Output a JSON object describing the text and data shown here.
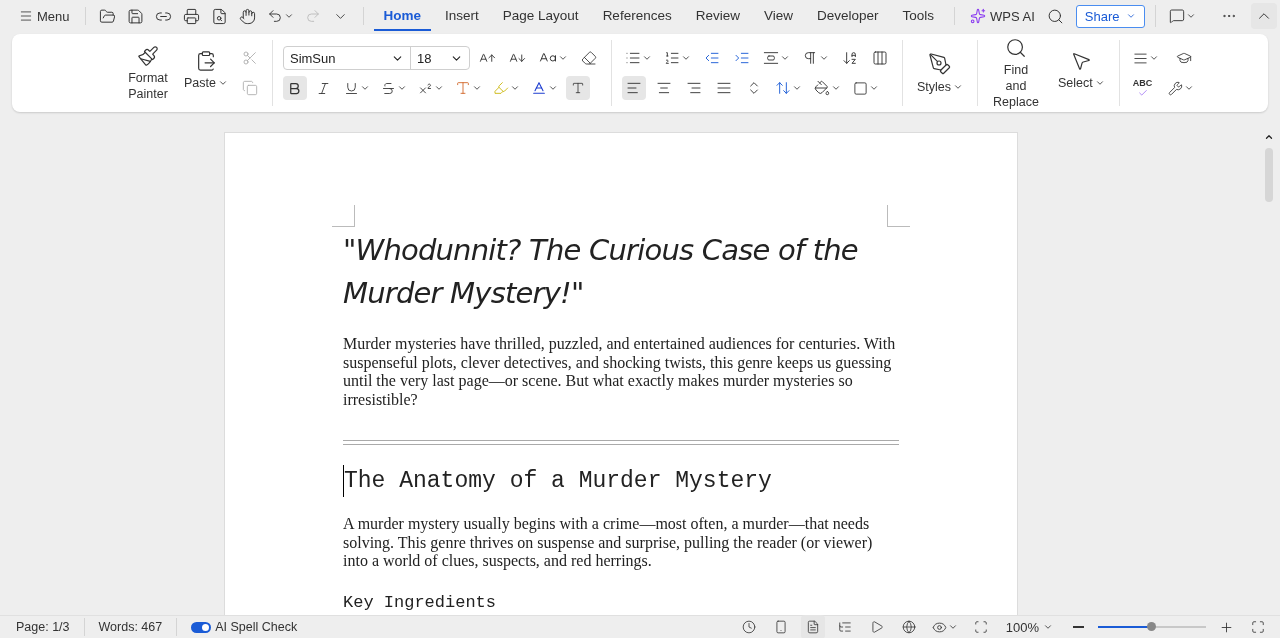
{
  "top_bar": {
    "menu_label": "Menu",
    "tabs": [
      {
        "label": "Home",
        "selected": true
      },
      {
        "label": "Insert",
        "selected": false
      },
      {
        "label": "Page Layout",
        "selected": false
      },
      {
        "label": "References",
        "selected": false
      },
      {
        "label": "Review",
        "selected": false
      },
      {
        "label": "View",
        "selected": false
      },
      {
        "label": "Developer",
        "selected": false
      },
      {
        "label": "Tools",
        "selected": false
      }
    ],
    "ai_label": "WPS AI",
    "share_label": "Share"
  },
  "ribbon": {
    "format_painter": "Format Painter",
    "paste": "Paste",
    "font_name": "SimSun",
    "font_size": "18",
    "font_styles": [
      {
        "kind": "bold",
        "selected": true
      },
      {
        "kind": "italic",
        "selected": false
      },
      {
        "kind": "underline",
        "selected": false
      },
      {
        "kind": "strikethrough",
        "selected": false
      },
      {
        "kind": "superscript",
        "selected": false
      }
    ],
    "alignments": [
      {
        "kind": "left",
        "selected": true
      },
      {
        "kind": "center",
        "selected": false
      },
      {
        "kind": "right",
        "selected": false
      },
      {
        "kind": "justify",
        "selected": false
      }
    ],
    "styles": "Styles",
    "find_replace": "Find and Replace",
    "select": "Select",
    "spell_label": "ABC"
  },
  "document": {
    "title": "\"Whodunnit? The Curious Case of the Murder Mystery!\"",
    "intro": "Murder mysteries have thrilled, puzzled, and entertained audiences for centuries. With suspenseful plots, clever detectives, and shocking twists, this genre keeps us guessing until the very last page—or scene. But what exactly makes murder mysteries so irresistible?",
    "heading": "The Anatomy of a Murder Mystery",
    "paragraph": "A murder mystery usually begins with a crime—most often, a murder—that needs solving. This genre thrives on suspense and surprise, pulling the reader (or viewer) into a world of clues, suspects, and red herrings.",
    "subheading": "Key Ingredients"
  },
  "status_bar": {
    "page": "Page: 1/3",
    "words": "Words: 467",
    "spell_check": {
      "label": "AI Spell Check",
      "on": true
    },
    "zoom": "100%",
    "zoom_slider": {
      "level": 0.49
    }
  }
}
